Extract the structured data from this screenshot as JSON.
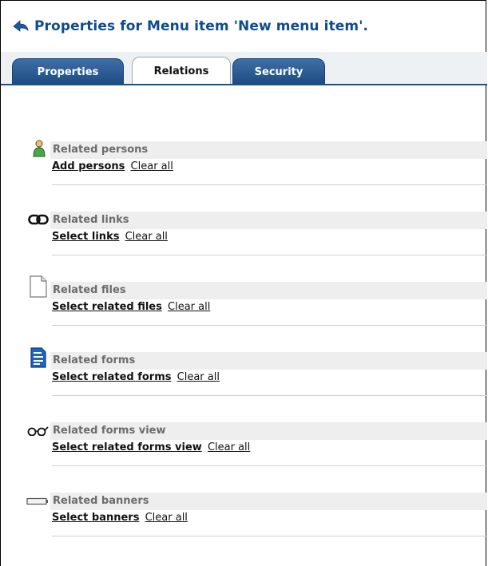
{
  "header": {
    "title": "Properties for Menu item 'New menu item'."
  },
  "tabs": [
    {
      "label": "Properties",
      "active": false
    },
    {
      "label": "Relations",
      "active": true
    },
    {
      "label": "Security",
      "active": false
    }
  ],
  "sections": [
    {
      "icon": "person-icon",
      "title": "Related persons",
      "primary_link": "Add persons",
      "secondary_link": "Clear all"
    },
    {
      "icon": "chain-link-icon",
      "title": "Related links",
      "primary_link": "Select links",
      "secondary_link": "Clear all"
    },
    {
      "icon": "blank-file-icon",
      "title": "Related files",
      "primary_link": "Select related files",
      "secondary_link": "Clear all"
    },
    {
      "icon": "form-document-icon",
      "title": "Related forms",
      "primary_link": "Select related forms",
      "secondary_link": "Clear all"
    },
    {
      "icon": "glasses-icon",
      "title": "Related forms view",
      "primary_link": "Select related forms view",
      "secondary_link": "Clear all"
    },
    {
      "icon": "banner-icon",
      "title": "Related banners",
      "primary_link": "Select banners",
      "secondary_link": "Clear all"
    }
  ],
  "colors": {
    "title": "#0f4c8a",
    "tab_active_bg": "#ffffff",
    "tab_inactive_bg": "#2a5b94",
    "section_header_bg": "#eeeeee"
  }
}
